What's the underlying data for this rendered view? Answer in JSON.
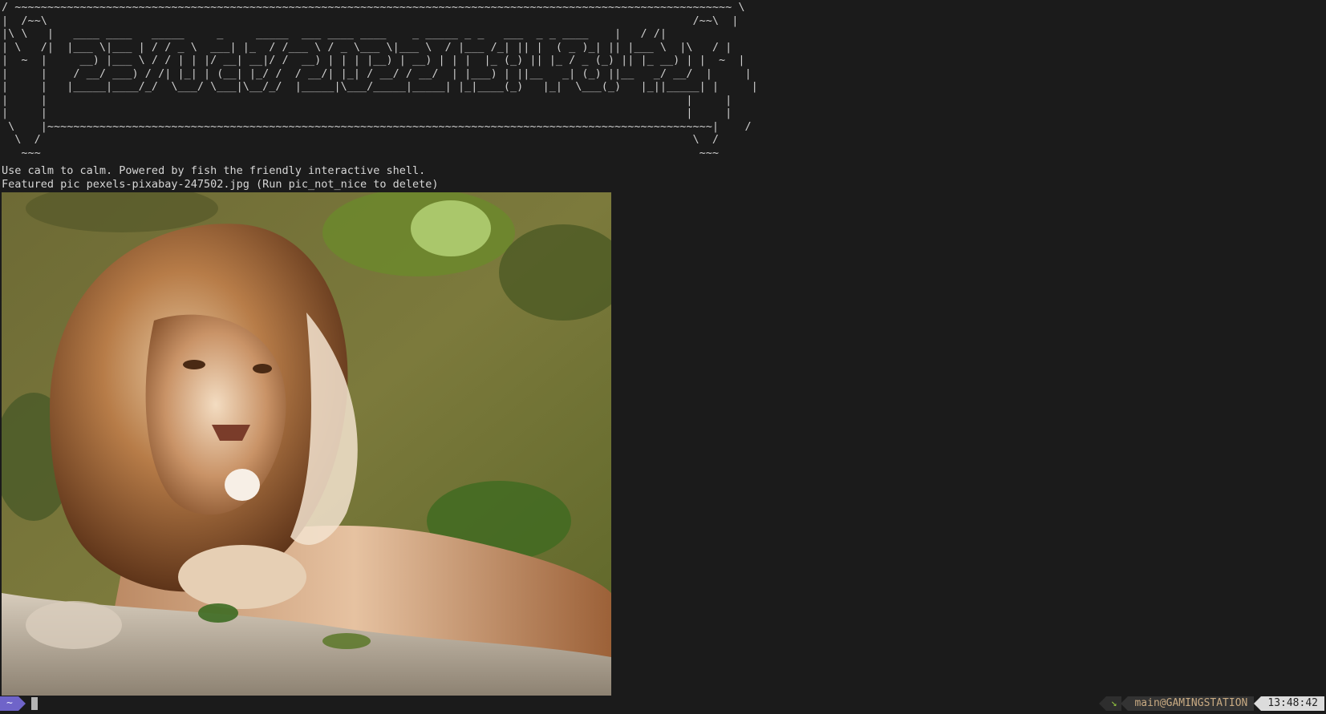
{
  "banner": {
    "ascii_art": "/ ~~~~~~~~~~~~~~~~~~~~~~~~~~~~~~~~~~~~~~~~~~~~~~~~~~~~~~~~~~~~~~~~~~~~~~~~~~~~~~~~~~~~~~~~~~~~~~~~~~~~~~~~~~~~~~ \\\n|  /~~\\                                                                                                   /~~\\  |\n|\\ \\   |   ____ ____   _____     _     _____  ___ ____ ____    _ _____ _ _   ___  _ _ ____    |   / /|\n| \\   /|  |___ \\|___ | / / _ \\  ___| |_  / /___ \\ / _ \\___ \\|___ \\  / |___ /_| || |  ( _ )_| || |___ \\  |\\   / |\n|  ~  |     __) |___ \\ / / | | |/ __| __|/ /  __) | | | |__) | __) | | |  |_ (_) || |_ / _ (_) || |_ __) | |  ~  |\n|     |    / __/ ___) / /| |_| | (__| |_/ /  / __/| |_| / __/ / __/  | |___) | ||__   _| (_) ||__   _/ __/  |     |\n|     |   |_____|____/_/  \\___/ \\___|\\__/_/  |_____|\\___/_____|_____| |_|____(_)   |_|  \\___(_)   |_||_____| |     |\n|     |                                                                                                  |     |\n|     |                                                                                                  |     |\n \\    |~~~~~~~~~~~~~~~~~~~~~~~~~~~~~~~~~~~~~~~~~~~~~~~~~~~~~~~~~~~~~~~~~~~~~~~~~~~~~~~~~~~~~~~~~~~~~~~~~~~~~~|    /\n  \\  /                                                                                                    \\  /\n   ~~~                                                                                                     ~~~"
  },
  "messages": {
    "line1": "Use calm to calm. Powered by fish the friendly interactive shell.",
    "line2": "Featured pic pexels-pixabay-247502.jpg (Run pic_not_nice to delete)"
  },
  "picture": {
    "subject": "lion"
  },
  "prompt": {
    "directory": "~",
    "status_glyph": "↘",
    "host": "main@GAMINGSTATION",
    "time": "13:48:42"
  },
  "colors": {
    "background": "#1b1b1b",
    "text": "#d6d6d6",
    "directory_segment": "#6f64c9",
    "time_segment": "#dcdcdc",
    "host_text": "#c9ab83",
    "status_glyph": "#8fbf3f"
  }
}
